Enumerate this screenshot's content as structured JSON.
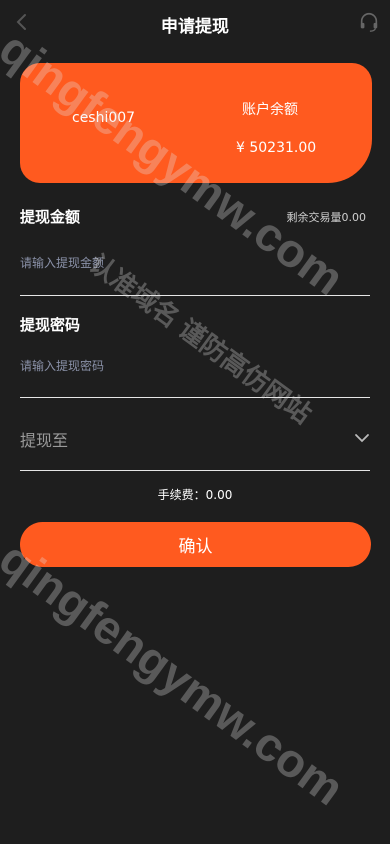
{
  "header": {
    "title": "申请提现",
    "back_icon": "chevron-left-icon",
    "support_icon": "headset-icon"
  },
  "balance_card": {
    "account_name": "ceshi007",
    "balance_label": "账户余额",
    "balance_value": "¥ 50231.00",
    "color": "#ff5a1f"
  },
  "amount_section": {
    "title": "提现金额",
    "remaining_volume": "剩余交易量0.00",
    "placeholder": "请输入提现金额",
    "value": ""
  },
  "password_section": {
    "title": "提现密码",
    "placeholder": "请输入提现密码",
    "value": ""
  },
  "withdraw_to": {
    "label": "提现至",
    "icon": "chevron-down-icon"
  },
  "fee": {
    "text": "手续费：0.00"
  },
  "confirm_button": {
    "label": "确认"
  },
  "watermarks": {
    "top": "qingfengymw.com",
    "middle": "认准域名 谨防高仿网站",
    "bottom": "qingfengymw.com"
  }
}
